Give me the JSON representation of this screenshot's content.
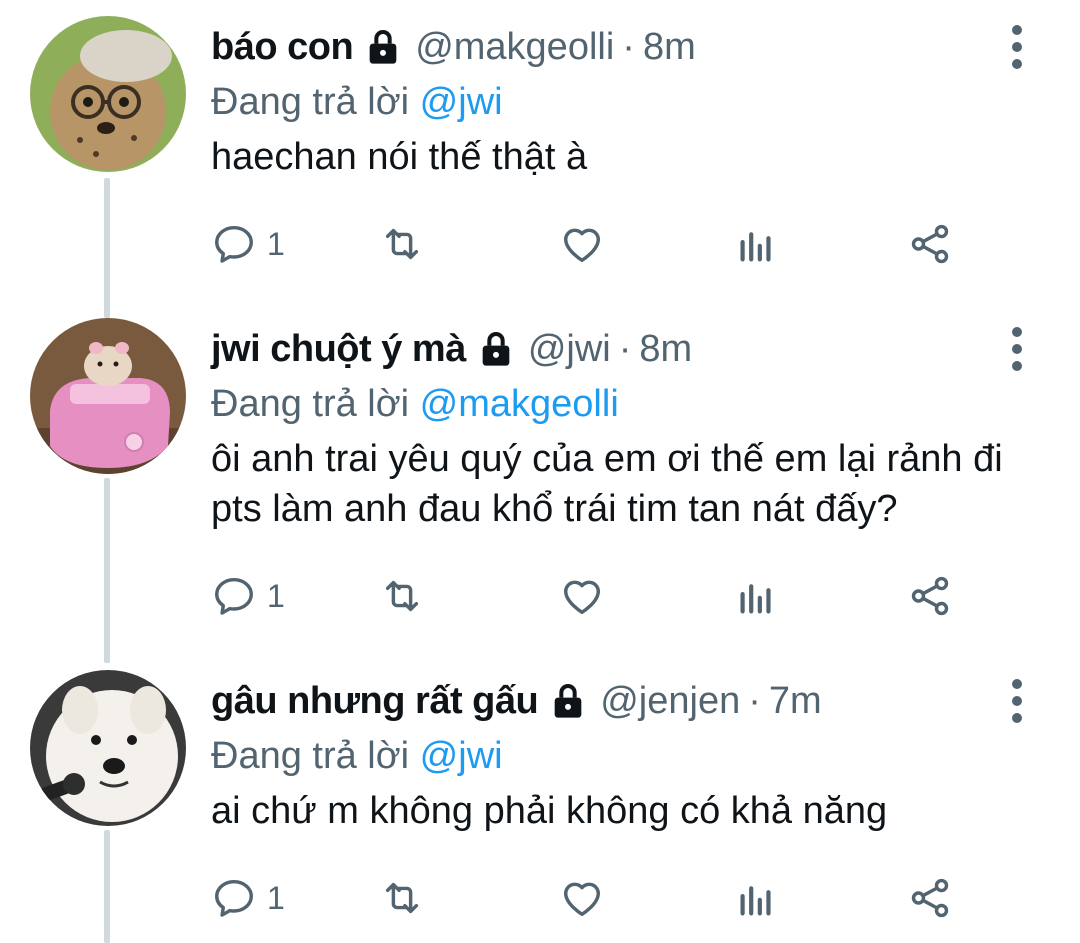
{
  "tweets": [
    {
      "name": "báo con",
      "handle": "@makgeolli",
      "dot": "·",
      "time": "8m",
      "reply_prefix": "Đang trả lời",
      "reply_to": "@jwi",
      "text": "haechan nói thế thật à",
      "reply_count": "1",
      "avatar": "cheetah-cub-with-glasses-and-cap"
    },
    {
      "name": "jwi chuột ý mà",
      "handle": "@jwi",
      "dot": "·",
      "time": "8m",
      "reply_prefix": "Đang trả lời",
      "reply_to": "@makgeolli",
      "text": "ôi anh trai yêu quý của em ơi thế em lại rảnh đi pts làm anh đau khổ trái tim tan nát đấy?",
      "reply_count": "1",
      "avatar": "hamster-in-pink-toy-car"
    },
    {
      "name": "gâu nhưng rất gấu",
      "handle": "@jenjen",
      "dot": "·",
      "time": "7m",
      "reply_prefix": "Đang trả lời",
      "reply_to": "@jwi",
      "text": "ai chứ m không phải không có khả năng",
      "reply_count": "1",
      "avatar": "white-fluffy-dog-with-microphone"
    }
  ],
  "icons": {
    "lock": "lock-icon",
    "reply": "reply-icon",
    "retweet": "retweet-icon",
    "like": "like-icon",
    "views": "views-icon",
    "share": "share-icon",
    "more": "more-vertical-icon"
  },
  "colors": {
    "accent": "#1d9bf0",
    "text": "#0f1419",
    "secondary": "#536471",
    "thread_line": "#cfd9de"
  }
}
